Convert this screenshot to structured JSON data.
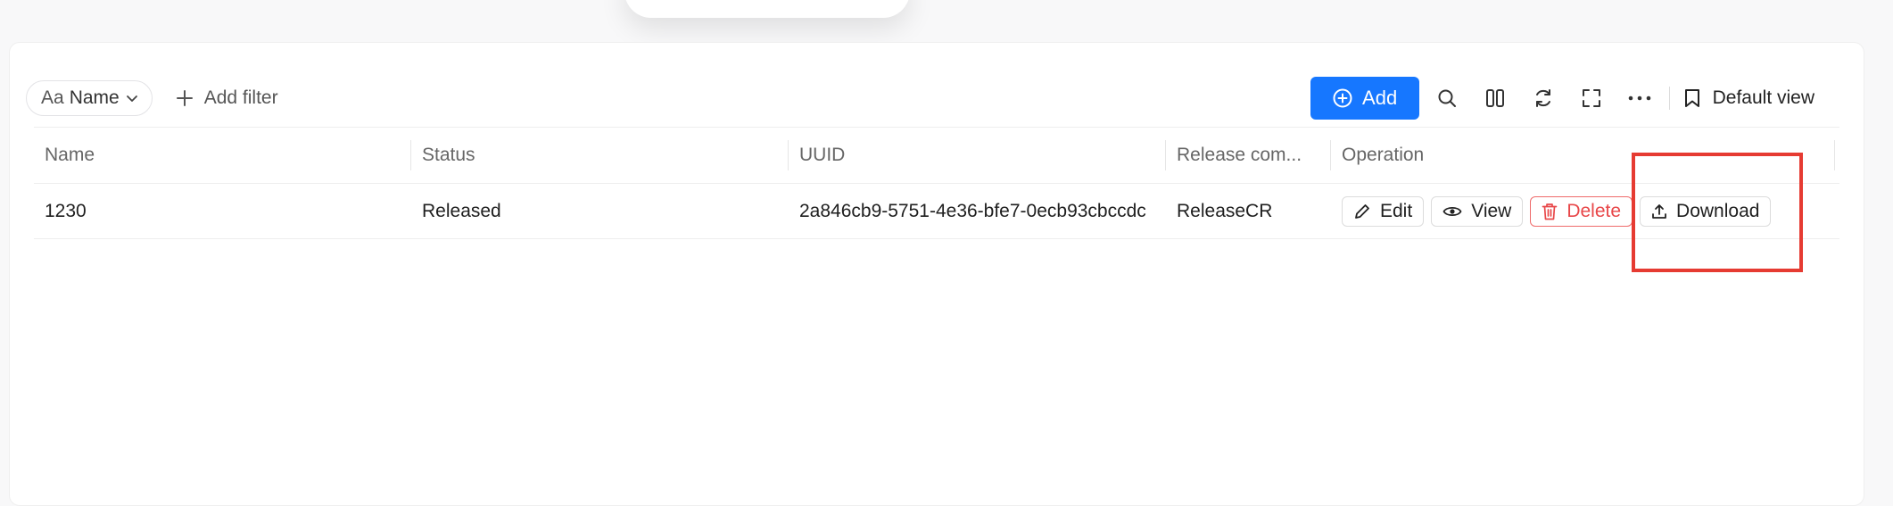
{
  "toolbar": {
    "field_prefix": "Aa",
    "field_label": "Name",
    "add_filter_label": "Add filter",
    "add_button_label": "Add",
    "default_view_label": "Default view",
    "accent_color": "#1677ff"
  },
  "table": {
    "columns": [
      "Name",
      "Status",
      "UUID",
      "Release com...",
      "Operation"
    ],
    "rows": [
      {
        "name": "1230",
        "status": "Released",
        "uuid": "2a846cb9-5751-4e36-bfe7-0ecb93cbccdc",
        "release_comment": "ReleaseCR",
        "actions": {
          "edit": "Edit",
          "view": "View",
          "delete": "Delete",
          "download": "Download"
        }
      }
    ]
  },
  "icons": {
    "field_chevron": "chevron-down-icon",
    "add_filter": "plus-icon",
    "add_button": "plus-circle-icon",
    "search": "search-icon",
    "columns": "columns-icon",
    "refresh": "refresh-icon",
    "fullscreen": "fullscreen-icon",
    "more": "more-icon",
    "default_view": "bookmark-icon",
    "edit": "pencil-icon",
    "view": "eye-icon",
    "delete": "trash-icon",
    "download": "upload-icon"
  },
  "annotation": {
    "highlight_color": "#e63b32"
  }
}
